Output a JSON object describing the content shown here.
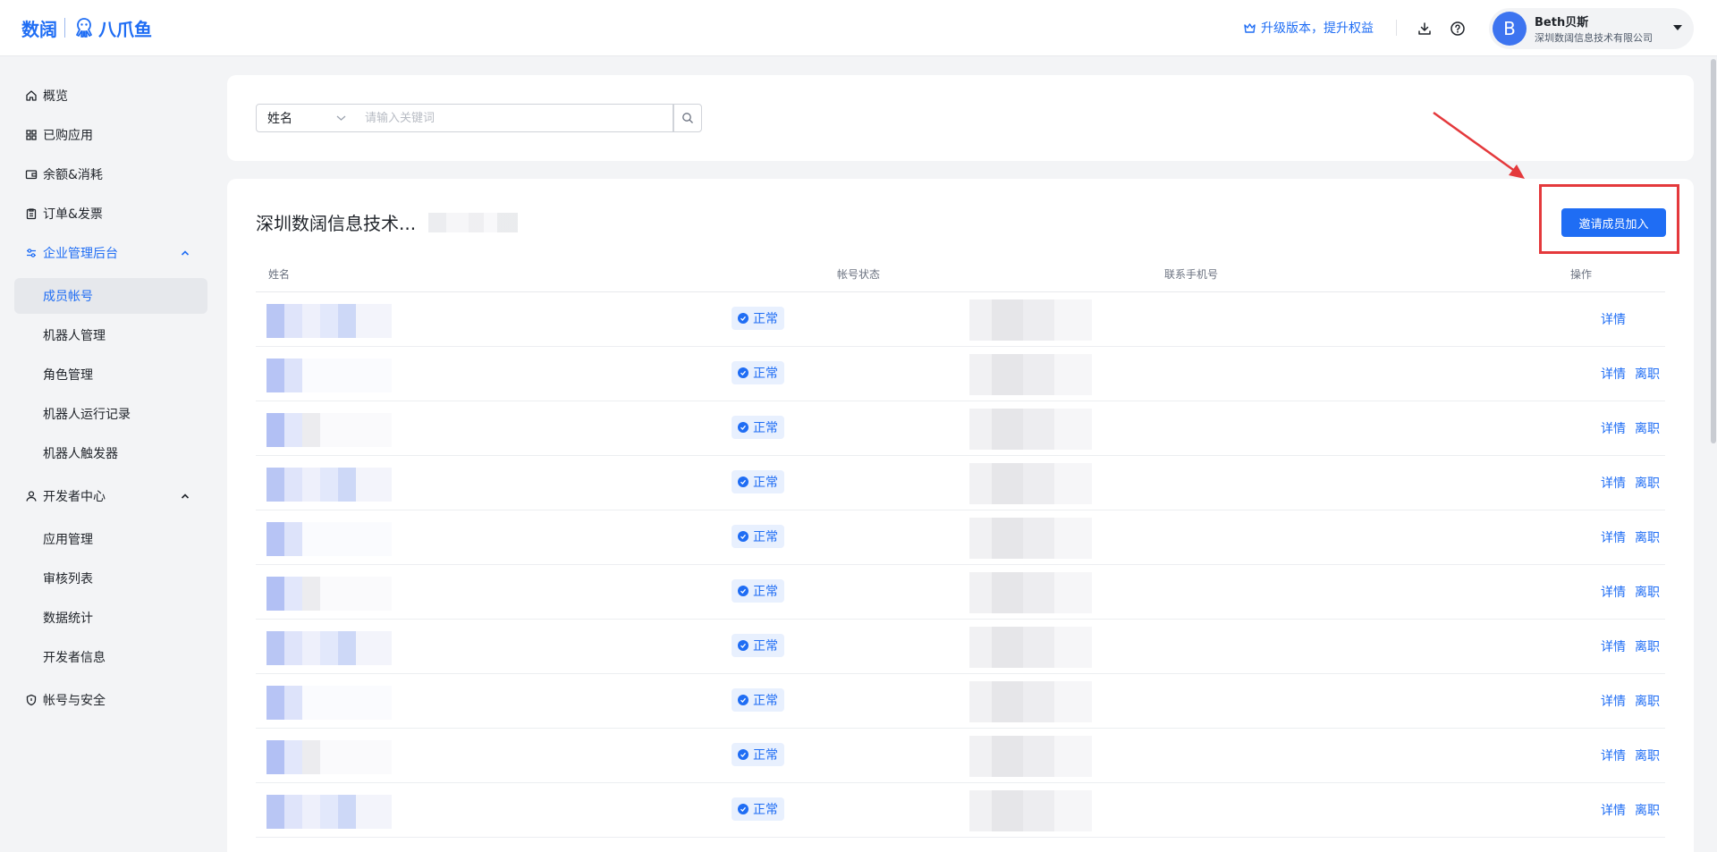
{
  "header": {
    "logo_left": "数阔",
    "logo_right": "八爪鱼",
    "upgrade_label": "升级版本，提升权益",
    "user": {
      "avatar_letter": "B",
      "name": "Beth贝斯",
      "org": "深圳数阔信息技术有限公司"
    }
  },
  "sidebar": {
    "items": [
      {
        "label": "概览",
        "icon": "home-icon"
      },
      {
        "label": "已购应用",
        "icon": "apps-icon"
      },
      {
        "label": "余额&消耗",
        "icon": "wallet-icon"
      },
      {
        "label": "订单&发票",
        "icon": "clipboard-icon"
      },
      {
        "label": "企业管理后台",
        "icon": "settings-sliders-icon",
        "expanded": true
      },
      {
        "label": "开发者中心",
        "icon": "user-icon",
        "expanded": true
      },
      {
        "label": "帐号与安全",
        "icon": "shield-icon"
      }
    ],
    "enterprise_sub": [
      "成员帐号",
      "机器人管理",
      "角色管理",
      "机器人运行记录",
      "机器人触发器"
    ],
    "developer_sub": [
      "应用管理",
      "审核列表",
      "数据统计",
      "开发者信息"
    ],
    "selected": "成员帐号"
  },
  "search": {
    "field": "姓名",
    "placeholder": "请输入关键词"
  },
  "table": {
    "org_title": "深圳数阔信息技术...",
    "invite_label": "邀请成员加入",
    "columns": [
      "姓名",
      "帐号状态",
      "联系手机号",
      "操作"
    ],
    "rows": [
      {
        "status": "正常",
        "actions": [
          "详情"
        ]
      },
      {
        "status": "正常",
        "actions": [
          "详情",
          "离职"
        ]
      },
      {
        "status": "正常",
        "actions": [
          "详情",
          "离职"
        ]
      },
      {
        "status": "正常",
        "actions": [
          "详情",
          "离职"
        ]
      },
      {
        "status": "正常",
        "actions": [
          "详情",
          "离职"
        ]
      },
      {
        "status": "正常",
        "actions": [
          "详情",
          "离职"
        ]
      },
      {
        "status": "正常",
        "actions": [
          "详情",
          "离职"
        ]
      },
      {
        "status": "正常",
        "actions": [
          "详情",
          "离职"
        ]
      },
      {
        "status": "正常",
        "actions": [
          "详情",
          "离职"
        ]
      },
      {
        "status": "正常",
        "actions": [
          "详情",
          "离职"
        ]
      }
    ]
  },
  "colors": {
    "accent": "#1f6df4",
    "annotation": "#e4393c"
  }
}
